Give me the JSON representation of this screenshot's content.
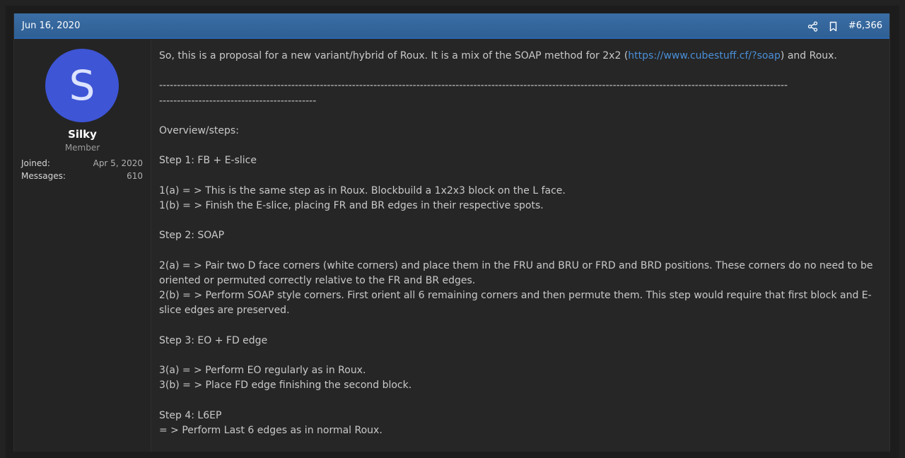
{
  "post": {
    "date": "Jun 16, 2020",
    "number": "#6,366"
  },
  "user": {
    "avatar_letter": "S",
    "name": "Silky",
    "title": "Member",
    "joined_label": "Joined:",
    "joined_value": "Apr 5, 2020",
    "messages_label": "Messages:",
    "messages_value": "610"
  },
  "body": {
    "intro_before": "So, this is a proposal for a new variant/hybrid of Roux. It is a mix of the SOAP method for 2x2 (",
    "intro_link": "https://www.cubestuff.cf/?soap",
    "intro_after": ") and Roux.",
    "divider_line1": "--------------------------------------------------------------------------------------------------------------------------------------------------------------------------------",
    "divider_line2": "--------------------------------------------",
    "overview": "Overview/steps:",
    "step1_title": "Step 1: FB + E-slice",
    "step1_a": "1(a) = > This is the same step as in Roux. Blockbuild a 1x2x3 block on the L face.",
    "step1_b": "1(b) = > Finish the E-slice, placing FR and BR edges in their respective spots.",
    "step2_title": "Step 2: SOAP",
    "step2_a": "2(a) = > Pair two D face corners (white corners) and place them in the FRU and BRU or FRD and BRD positions. These corners do no need to be oriented or permuted correctly relative to the FR and BR edges.",
    "step2_b": "2(b) = > Perform SOAP style corners. First orient all 6 remaining corners and then permute them. This step would require that first block and E-slice edges are preserved.",
    "step3_title": "Step 3: EO + FD edge",
    "step3_a": "3(a) = > Perform EO regularly as in Roux.",
    "step3_b": "3(b) = > Place FD edge finishing the second block.",
    "step4_title": "Step 4: L6EP",
    "step4_a": "= > Perform Last 6 edges as in normal Roux."
  },
  "icons": {
    "share": "share-icon",
    "bookmark": "bookmark-icon"
  },
  "colors": {
    "header": "#3a6ea5",
    "avatar": "#3e55d6",
    "link": "#4a8fd8",
    "background": "#262626"
  }
}
